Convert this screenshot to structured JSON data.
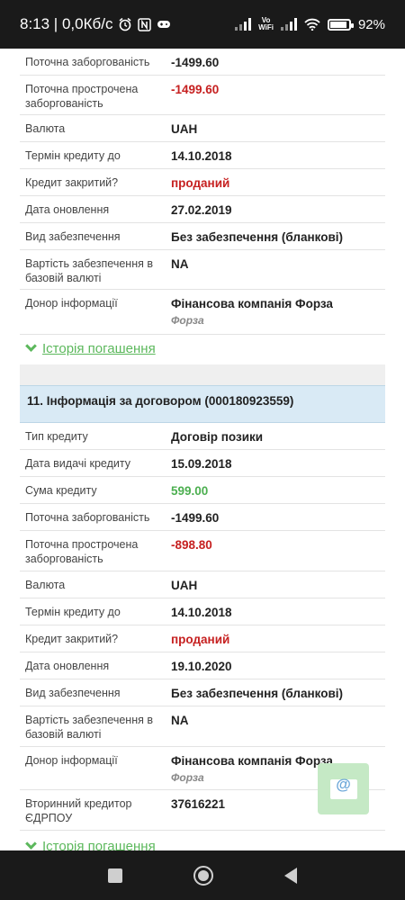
{
  "status_bar": {
    "time_speed": "8:13 | 0,0Кб/с",
    "vowifi_line1": "Vo",
    "vowifi_line2": "WiFi",
    "battery": "92%",
    "battery_level": 0.92,
    "icons": [
      "alarm-icon",
      "nfc-icon",
      "gamepad-icon",
      "signal-icon",
      "vowifi-icon",
      "wifi-icon",
      "battery-icon"
    ]
  },
  "contract10": {
    "rows": [
      {
        "label": "Поточна заборгованість",
        "value": "-1499.60"
      },
      {
        "label": "Поточна прострочена заборгованість",
        "value": "-1499.60",
        "color": "red"
      },
      {
        "label": "Валюта",
        "value": "UAH"
      },
      {
        "label": "Термін кредиту до",
        "value": "14.10.2018"
      },
      {
        "label": "Кредит закритий?",
        "value": "проданий",
        "color": "red"
      },
      {
        "label": "Дата оновлення",
        "value": "27.02.2019"
      },
      {
        "label": "Вид забезпечення",
        "value": "Без забезпечення (бланкові)"
      },
      {
        "label": "Вартість забезпечення в базовій валюті",
        "value": "NA"
      },
      {
        "label": "Донор інформації",
        "value": "Фінансова компанія Форза",
        "sub": "Форза"
      }
    ],
    "history_link": "Історія погашення"
  },
  "contract11": {
    "title": "11. Інформація за договором (000180923559)",
    "rows": [
      {
        "label": "Тип кредиту",
        "value": "Договір позики"
      },
      {
        "label": "Дата видачі кредиту",
        "value": "15.09.2018"
      },
      {
        "label": "Сума кредиту",
        "value": "599.00",
        "color": "green"
      },
      {
        "label": "Поточна заборгованість",
        "value": "-1499.60"
      },
      {
        "label": "Поточна прострочена заборгованість",
        "value": "-898.80",
        "color": "red"
      },
      {
        "label": "Валюта",
        "value": "UAH"
      },
      {
        "label": "Термін кредиту до",
        "value": "14.10.2018"
      },
      {
        "label": "Кредит закритий?",
        "value": "проданий",
        "color": "red"
      },
      {
        "label": "Дата оновлення",
        "value": "19.10.2020"
      },
      {
        "label": "Вид забезпечення",
        "value": "Без забезпечення (бланкові)"
      },
      {
        "label": "Вартість забезпечення в базовій валюті",
        "value": "NA"
      },
      {
        "label": "Донор інформації",
        "value": "Фінансова компанія Форза",
        "sub": "Форза"
      },
      {
        "label": "Вторинний кредитор ЄДРПОУ",
        "value": "37616221"
      }
    ],
    "history_link": "Історія погашення"
  },
  "fab": {
    "icon": "email-icon",
    "symbol": "@"
  },
  "colors": {
    "red": "#c62020",
    "green": "#4caf50",
    "link": "#5cb85c",
    "header_bg": "#d9eaf5"
  }
}
